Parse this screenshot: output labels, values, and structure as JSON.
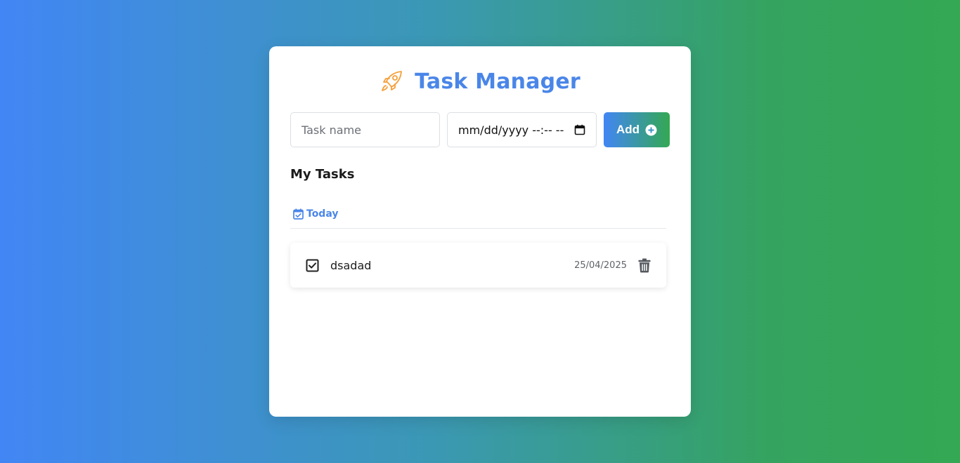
{
  "app": {
    "title": "Task Manager",
    "logo_icon": "rocket-icon"
  },
  "form": {
    "task_name_placeholder": "Task name",
    "date_placeholder": "mm/dd/yyyy --:-- --",
    "date_icon": "calendar-icon",
    "add_label": "Add",
    "add_icon": "plus-circle-icon"
  },
  "tasks_section": {
    "title": "My Tasks",
    "groups": [
      {
        "label": "Today",
        "icon": "calendar-check-icon",
        "tasks": [
          {
            "name": "dsadad",
            "date": "25/04/2025",
            "completed": true
          }
        ]
      }
    ]
  },
  "colors": {
    "accent_blue": "#4a86e8",
    "accent_green": "#34a853",
    "rocket": "#f4a13b"
  }
}
